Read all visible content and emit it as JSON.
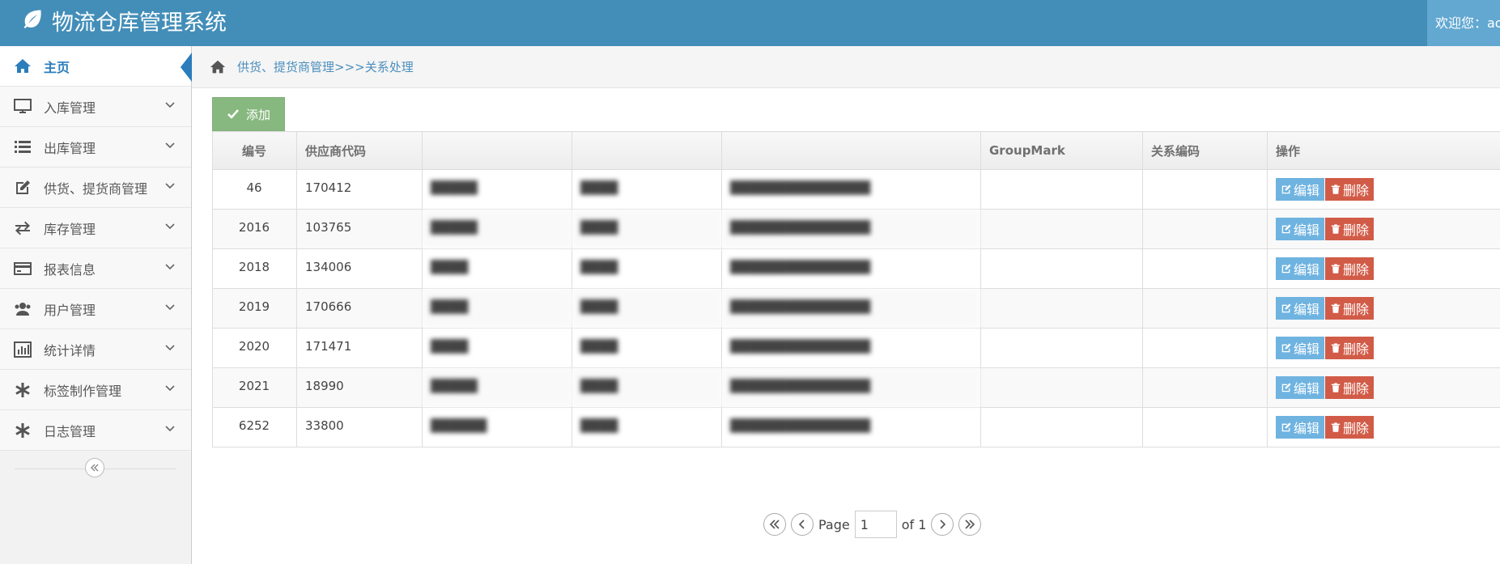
{
  "app": {
    "title": "物流仓库管理系统",
    "welcome": "欢迎您：ac"
  },
  "sidebar": {
    "items": [
      {
        "label": "主页",
        "icon": "home-icon",
        "active": true
      },
      {
        "label": "入库管理",
        "icon": "desktop-icon"
      },
      {
        "label": "出库管理",
        "icon": "list-icon"
      },
      {
        "label": "供货、提货商管理",
        "icon": "edit-icon"
      },
      {
        "label": "库存管理",
        "icon": "exchange-icon"
      },
      {
        "label": "报表信息",
        "icon": "credit-card-icon"
      },
      {
        "label": "用户管理",
        "icon": "users-icon"
      },
      {
        "label": "统计详情",
        "icon": "bar-chart-icon"
      },
      {
        "label": "标签制作管理",
        "icon": "asterisk-icon"
      },
      {
        "label": "日志管理",
        "icon": "asterisk-icon"
      }
    ]
  },
  "breadcrumb": {
    "text": "供货、提货商管理>>>关系处理"
  },
  "toolbar": {
    "add_label": "添加"
  },
  "table": {
    "headers": [
      "编号",
      "供应商代码",
      "",
      "",
      "",
      "GroupMark",
      "关系编码",
      "操作"
    ],
    "rows": [
      {
        "id": "46",
        "supplier_code": "170412",
        "c3": "█████",
        "c4": "████",
        "c5": "███████████████",
        "group_mark": "",
        "relation_code": ""
      },
      {
        "id": "2016",
        "supplier_code": "103765",
        "c3": "█████",
        "c4": "████",
        "c5": "███████████████",
        "group_mark": "",
        "relation_code": ""
      },
      {
        "id": "2018",
        "supplier_code": "134006",
        "c3": "████",
        "c4": "████",
        "c5": "███████████████",
        "group_mark": "",
        "relation_code": ""
      },
      {
        "id": "2019",
        "supplier_code": "170666",
        "c3": "████",
        "c4": "████",
        "c5": "███████████████",
        "group_mark": "",
        "relation_code": ""
      },
      {
        "id": "2020",
        "supplier_code": "171471",
        "c3": "████",
        "c4": "████",
        "c5": "███████████████",
        "group_mark": "",
        "relation_code": ""
      },
      {
        "id": "2021",
        "supplier_code": "18990",
        "c3": "█████",
        "c4": "████",
        "c5": "███████████████",
        "group_mark": "",
        "relation_code": ""
      },
      {
        "id": "6252",
        "supplier_code": "33800",
        "c3": "██████",
        "c4": "████",
        "c5": "███████████████",
        "group_mark": "",
        "relation_code": ""
      }
    ],
    "edit_label": "编辑",
    "delete_label": "删除"
  },
  "pager": {
    "page_label": "Page",
    "current": "1",
    "of_label": "of 1"
  },
  "colors": {
    "header": "#438eb9",
    "accent": "#2b7dbc",
    "add_button": "#87b87f",
    "edit_button": "#6fb3e0",
    "delete_button": "#d15b47"
  }
}
